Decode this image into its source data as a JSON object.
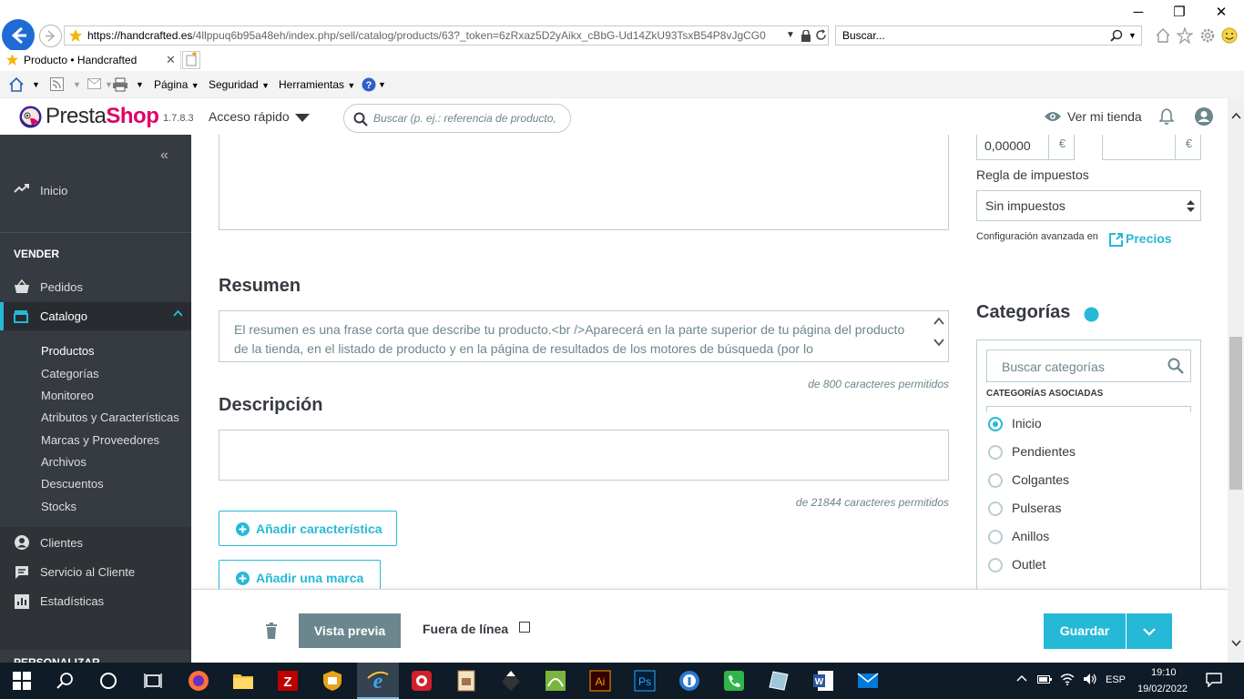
{
  "browser": {
    "url_host": "https://handcrafted.es",
    "url_path": "/4llppuq6b95a48eh/index.php/sell/catalog/products/63?_token=6zRxaz5D2yAikx_cBbG-Ud14ZkU93TsxB54P8vJgCG0",
    "search_placeholder": "Buscar...",
    "tab_title": "Producto • Handcrafted",
    "menu": {
      "page": "Página",
      "security": "Seguridad",
      "tools": "Herramientas"
    }
  },
  "header": {
    "logo": "PrestaShop",
    "version": "1.7.8.3",
    "quick_access": "Acceso rápido",
    "search_placeholder": "Buscar (p. ej.: referencia de producto,",
    "view_store": "Ver mi tienda"
  },
  "sidebar": {
    "home": "Inicio",
    "sell_heading": "VENDER",
    "orders": "Pedidos",
    "catalog": "Catalogo",
    "catalog_items": [
      "Productos",
      "Categorías",
      "Monitoreo",
      "Atributos y Características",
      "Marcas y Proveedores",
      "Archivos",
      "Descuentos",
      "Stocks"
    ],
    "customers": "Clientes",
    "customer_service": "Servicio al Cliente",
    "stats": "Estadísticas",
    "customize_heading": "PERSONALIZAR"
  },
  "main": {
    "summary_title": "Resumen",
    "summary_text": "El resumen es una frase corta que describe tu producto.<br />Aparecerá en la parte superior de tu página del producto de la tienda, en el listado de producto y en la página de resultados de los motores de búsqueda (por lo",
    "summary_hint": "de 800 caracteres permitidos",
    "description_title": "Descripción",
    "description_hint": "de 21844 caracteres permitidos",
    "add_feature": "Añadir característica",
    "add_brand": "Añadir una marca"
  },
  "right_panel": {
    "price_value": "0,00000",
    "currency": "€",
    "tax_rule_label": "Regla de impuestos",
    "tax_rule_value": "Sin impuestos",
    "advanced_config": "Configuración avanzada en",
    "prices_link": "Precios",
    "categories_title": "Categorías",
    "search_categories_placeholder": "Buscar categorías",
    "associated_categories": "CATEGORÍAS ASOCIADAS",
    "categories": [
      {
        "label": "Inicio",
        "selected": true
      },
      {
        "label": "Pendientes",
        "selected": false
      },
      {
        "label": "Colgantes",
        "selected": false
      },
      {
        "label": "Pulseras",
        "selected": false
      },
      {
        "label": "Anillos",
        "selected": false
      },
      {
        "label": "Outlet",
        "selected": false
      }
    ]
  },
  "footer": {
    "preview": "Vista previa",
    "offline": "Fuera de línea",
    "save": "Guardar"
  },
  "taskbar": {
    "lang": "ESP",
    "time": "19:10",
    "date": "19/02/2022"
  },
  "colors": {
    "accent": "#25b9d7",
    "sidebar": "#363a41",
    "preview_btn": "#6c868e"
  }
}
